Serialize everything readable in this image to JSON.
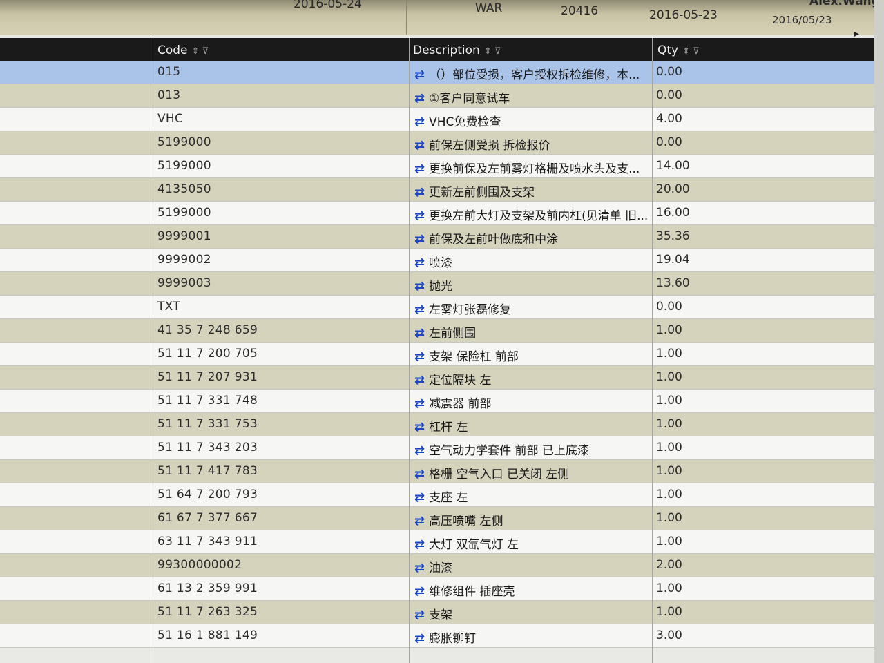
{
  "prev_row": {
    "date1": "2016-05-24",
    "type": "WAR",
    "num": "20416",
    "date2": "2016-05-23",
    "date3": "2016/05/23",
    "user": "Alex.Wang"
  },
  "columns": {
    "code": "Code",
    "description": "Description",
    "qty": "Qty"
  },
  "icons": {
    "sort": "sort-icon",
    "filter": "filter-icon",
    "swap": "swap-arrows-icon"
  },
  "colors": {
    "header_bg": "#1a1a1a",
    "selected_row": "#a9c4e8",
    "alt_row": "#d6d3bd",
    "swap_icon": "#1846c8"
  },
  "rows": [
    {
      "code": "015",
      "desc": "（）部位受损，客户授权拆检维修，本...",
      "qty": "0.00"
    },
    {
      "code": "013",
      "desc": "①客户同意试车",
      "qty": "0.00"
    },
    {
      "code": "VHC",
      "desc": "VHC免费检查",
      "qty": "4.00"
    },
    {
      "code": "5199000",
      "desc": "前保左侧受损 拆检报价",
      "qty": "0.00"
    },
    {
      "code": "5199000",
      "desc": "更换前保及左前雾灯格栅及喷水头及支...",
      "qty": "14.00"
    },
    {
      "code": "4135050",
      "desc": "更新左前侧围及支架",
      "qty": "20.00"
    },
    {
      "code": "5199000",
      "desc": "更换左前大灯及支架及前内杠(见清单 旧...",
      "qty": "16.00"
    },
    {
      "code": "9999001",
      "desc": "前保及左前叶做底和中涂",
      "qty": "35.36"
    },
    {
      "code": "9999002",
      "desc": "喷漆",
      "qty": "19.04"
    },
    {
      "code": "9999003",
      "desc": "抛光",
      "qty": "13.60"
    },
    {
      "code": "TXT",
      "desc": "左雾灯张磊修复",
      "qty": "0.00"
    },
    {
      "code": "41 35 7 248 659",
      "desc": "左前侧围",
      "qty": "1.00"
    },
    {
      "code": "51 11 7 200 705",
      "desc": "支架 保险杠 前部",
      "qty": "1.00"
    },
    {
      "code": "51 11 7 207 931",
      "desc": "定位隔块 左",
      "qty": "1.00"
    },
    {
      "code": "51 11 7 331 748",
      "desc": "减震器 前部",
      "qty": "1.00"
    },
    {
      "code": "51 11 7 331 753",
      "desc": "杠杆 左",
      "qty": "1.00"
    },
    {
      "code": "51 11 7 343 203",
      "desc": "空气动力学套件 前部 已上底漆",
      "qty": "1.00"
    },
    {
      "code": "51 11 7 417 783",
      "desc": "格栅 空气入口 已关闭 左侧",
      "qty": "1.00"
    },
    {
      "code": "51 64 7 200 793",
      "desc": "支座 左",
      "qty": "1.00"
    },
    {
      "code": "61 67 7 377 667",
      "desc": "高压喷嘴 左侧",
      "qty": "1.00"
    },
    {
      "code": "63 11 7 343 911",
      "desc": "大灯 双氙气灯 左",
      "qty": "1.00"
    },
    {
      "code": "99300000002",
      "desc": "油漆",
      "qty": "2.00"
    },
    {
      "code": "61 13 2 359 991",
      "desc": "维修组件 插座壳",
      "qty": "1.00"
    },
    {
      "code": "51 11 7 263 325",
      "desc": "支架",
      "qty": "1.00"
    },
    {
      "code": "51 16 1 881 149",
      "desc": "膨胀铆钉",
      "qty": "3.00"
    }
  ]
}
